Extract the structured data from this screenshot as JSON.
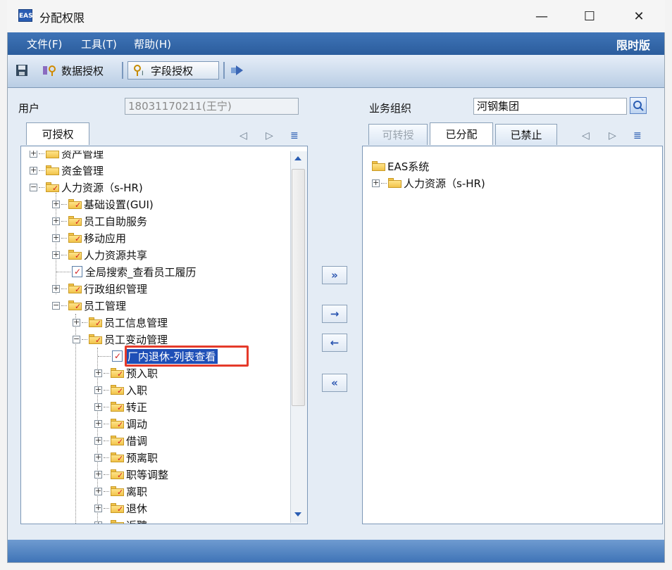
{
  "window": {
    "title": "分配权限",
    "app_icon_text": "EAS"
  },
  "menu": {
    "items": [
      "文件(F)",
      "工具(T)",
      "帮助(H)"
    ],
    "edition": "限时版"
  },
  "toolbar": {
    "data_auth": "数据授权",
    "field_auth": "字段授权"
  },
  "user": {
    "label": "用户",
    "value": "18031170211(王宁)"
  },
  "org": {
    "label": "业务组织",
    "value": "河钢集团"
  },
  "left_tabs": [
    "可授权"
  ],
  "right_tabs": [
    "可转授",
    "已分配",
    "已禁止"
  ],
  "left_tree": [
    "资产管理",
    "资金管理",
    "人力资源（s-HR)",
    "基础设置(GUI)",
    "员工自助服务",
    "移动应用",
    "人力资源共享",
    "全局搜索_查看员工履历",
    "行政组织管理",
    "员工管理",
    "员工信息管理",
    "员工变动管理",
    "厂内退休-列表查看",
    "预入职",
    "入职",
    "转正",
    "调动",
    "借调",
    "预离职",
    "职等调整",
    "离职",
    "退休",
    "返聘"
  ],
  "right_tree": [
    "EAS系统",
    "人力资源（s-HR)"
  ],
  "move_buttons": [
    "»",
    "→",
    "←",
    "«"
  ],
  "colors": {
    "menubar": "#3f74b7",
    "selection": "#1e4fb7",
    "highlight": "#e53a2a"
  }
}
